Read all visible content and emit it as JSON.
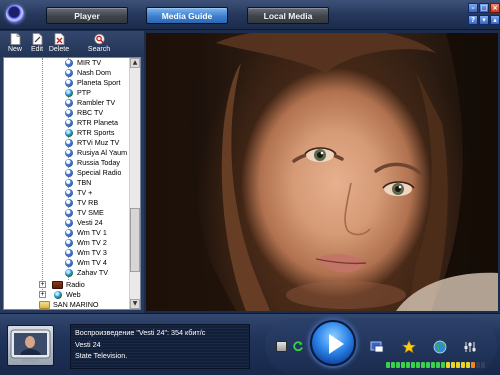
{
  "tabs": [
    {
      "label": "Player"
    },
    {
      "label": "Media Guide"
    },
    {
      "label": "Local Media"
    }
  ],
  "toolbar": {
    "new_label": "New",
    "edit_label": "Edit",
    "delete_label": "Delete",
    "search_label": "Search"
  },
  "tree": {
    "channels": [
      {
        "label": "MIR TV"
      },
      {
        "label": "Nash Dom"
      },
      {
        "label": "Planeta Sport"
      },
      {
        "label": "PTP"
      },
      {
        "label": "Rambler TV"
      },
      {
        "label": "RBC TV"
      },
      {
        "label": "RTR Planeta"
      },
      {
        "label": "RTR Sports"
      },
      {
        "label": "RTVi Muz TV"
      },
      {
        "label": "Rusiya Al Yaum"
      },
      {
        "label": "Russia Today"
      },
      {
        "label": "Special Radio"
      },
      {
        "label": "TBN"
      },
      {
        "label": "TV +"
      },
      {
        "label": "TV RB"
      },
      {
        "label": "TV SME"
      },
      {
        "label": "Vesti 24"
      },
      {
        "label": "Wm TV 1"
      },
      {
        "label": "Wm TV 2"
      },
      {
        "label": "Wm TV 3"
      },
      {
        "label": "Wm TV 4"
      },
      {
        "label": "Zahav TV"
      }
    ],
    "radio_label": "Radio",
    "web_label": "Web",
    "country_label": "SAN MARINO"
  },
  "now_playing": {
    "line1": "Воспроизведение \"Vesti 24\": 354 кбит/с",
    "line2": "Vesti 24",
    "line3": "State Television."
  },
  "volume": {
    "level": 0.9
  }
}
